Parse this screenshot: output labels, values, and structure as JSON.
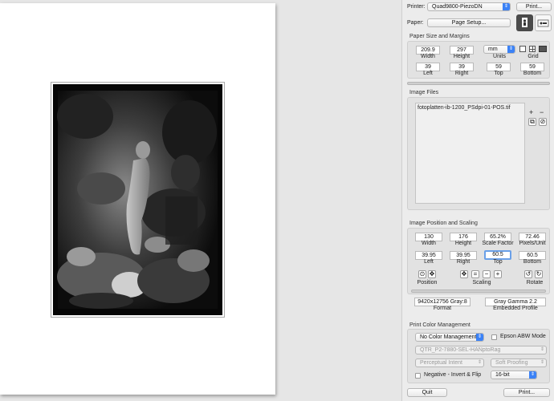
{
  "printer": {
    "label": "Printer:",
    "value": "Quad9800-PiezoDN",
    "print_button": "Print..."
  },
  "paper": {
    "label": "Paper:",
    "page_setup_button": "Page Setup..."
  },
  "paper_size": {
    "title": "Paper Size and Margins",
    "width": "209.9",
    "width_label": "Width",
    "height": "297",
    "height_label": "Height",
    "units": "mm",
    "units_label": "Units",
    "grid_label": "Grid",
    "left": "39",
    "left_label": "Left",
    "right": "39",
    "right_label": "Right",
    "top": "59",
    "top_label": "Top",
    "bottom": "59",
    "bottom_label": "Bottom"
  },
  "image_files": {
    "title": "Image Files",
    "files": [
      "fotoplatten-ib-1200_PSdpi-01-POS.tif"
    ]
  },
  "position": {
    "title": "Image Position and Scaling",
    "width": "130",
    "width_label": "Width",
    "height": "176",
    "height_label": "Height",
    "scale": "65.2%",
    "scale_label": "Scale Factor",
    "ppu": "72.46",
    "ppu_label": "Pixels/Unit",
    "left": "39.95",
    "left_label": "Left",
    "right": "39.95",
    "right_label": "Right",
    "top": "60.5",
    "top_label": "Top",
    "bottom": "60.5",
    "bottom_label": "Bottom",
    "position_label": "Position",
    "scaling_label": "Scaling",
    "rotate_label": "Rotate",
    "format": "9420x12756 Gray:8",
    "format_label": "Format",
    "profile": "Gray Gamma 2.2",
    "profile_label": "Embedded Profile"
  },
  "color": {
    "title": "Print Color Management",
    "management": "No Color Management",
    "epson_abw": "Epson ABW Mode",
    "profile": "QTR_P2-7880-SEL-HANptoRag",
    "intent": "Perceptual Intent",
    "proofing": "Soft Proofing",
    "negative": "Negative - Invert & Flip",
    "bits": "16-bit"
  },
  "footer": {
    "quit": "Quit",
    "print": "Print..."
  }
}
